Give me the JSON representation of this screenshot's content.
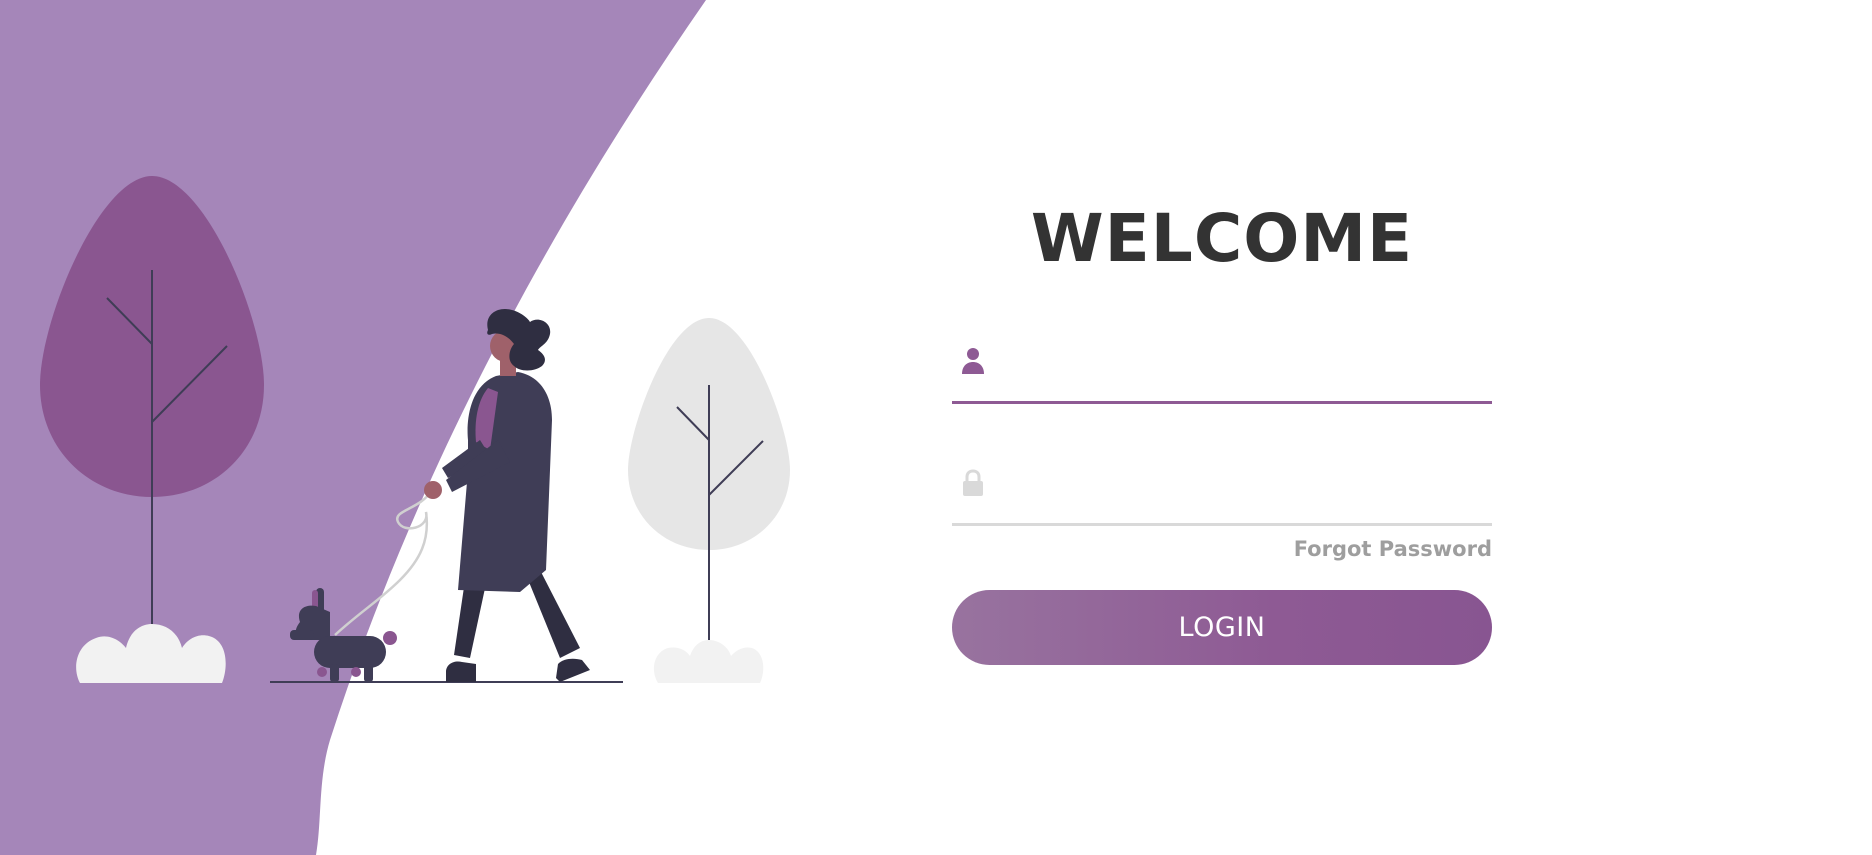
{
  "login": {
    "title": "WELCOME",
    "username": {
      "icon": "user-icon",
      "value": "",
      "placeholder": ""
    },
    "password": {
      "icon": "lock-icon",
      "value": "",
      "placeholder": ""
    },
    "forgot_label": "Forgot Password",
    "submit_label": "LOGIN"
  },
  "colors": {
    "background_wave": "#a586b9",
    "accent": "#8e5a94",
    "text_dark": "#333333",
    "muted": "#9e9e9e",
    "field_underline": "#d9d9d9"
  }
}
